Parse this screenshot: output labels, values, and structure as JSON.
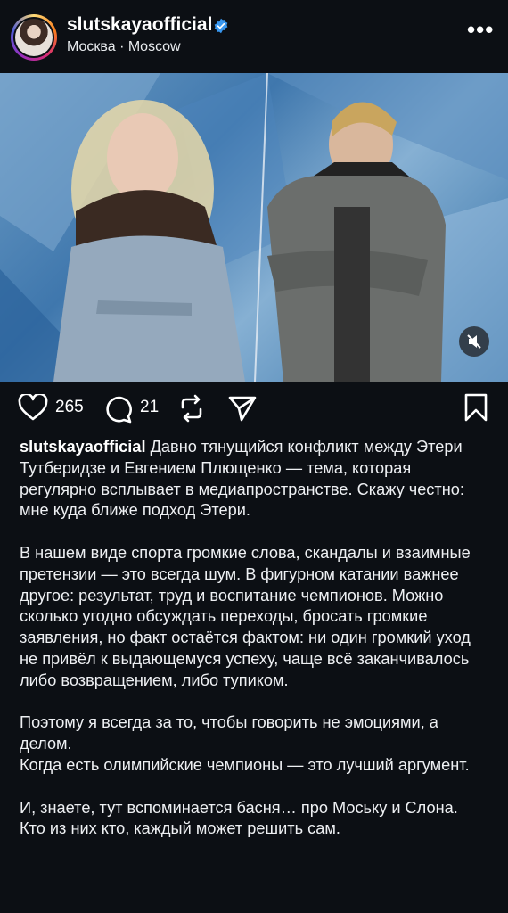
{
  "header": {
    "username": "slutskayaofficial",
    "location": "Москва · Moscow",
    "more_icon": "more-horizontal-icon"
  },
  "media": {
    "type": "image",
    "description_icon": "video-muted-icon",
    "colors": {
      "background": "#3f77ad",
      "panel": "#0c0f14"
    }
  },
  "actions": {
    "likes": "265",
    "comments": "21"
  },
  "caption": {
    "username": "slutskayaofficial",
    "paragraphs": [
      "Давно тянущийся конфликт между Этери Тутберидзе и Евгением Плющенко — тема, которая регулярно всплывает в медиапространстве. Скажу честно: мне куда ближе подход Этери.",
      "В нашем виде спорта громкие слова, скандалы и взаимные претензии — это всегда шум. В фигурном катании важнее другое: результат, труд и воспитание чемпионов. Можно сколько угодно обсуждать переходы, бросать громкие заявления, но факт остаётся фактом: ни один громкий уход не привёл к выдающемуся успеху, чаще всё заканчивалось либо возвращением, либо тупиком.",
      "Поэтому я всегда за то, чтобы говорить не эмоциями, а делом.",
      "Когда есть олимпийские чемпионы — это лучший аргумент.",
      "И, знаете, тут вспоминается басня… про Моську и Слона.",
      "Кто из них кто, каждый может решить сам."
    ]
  }
}
